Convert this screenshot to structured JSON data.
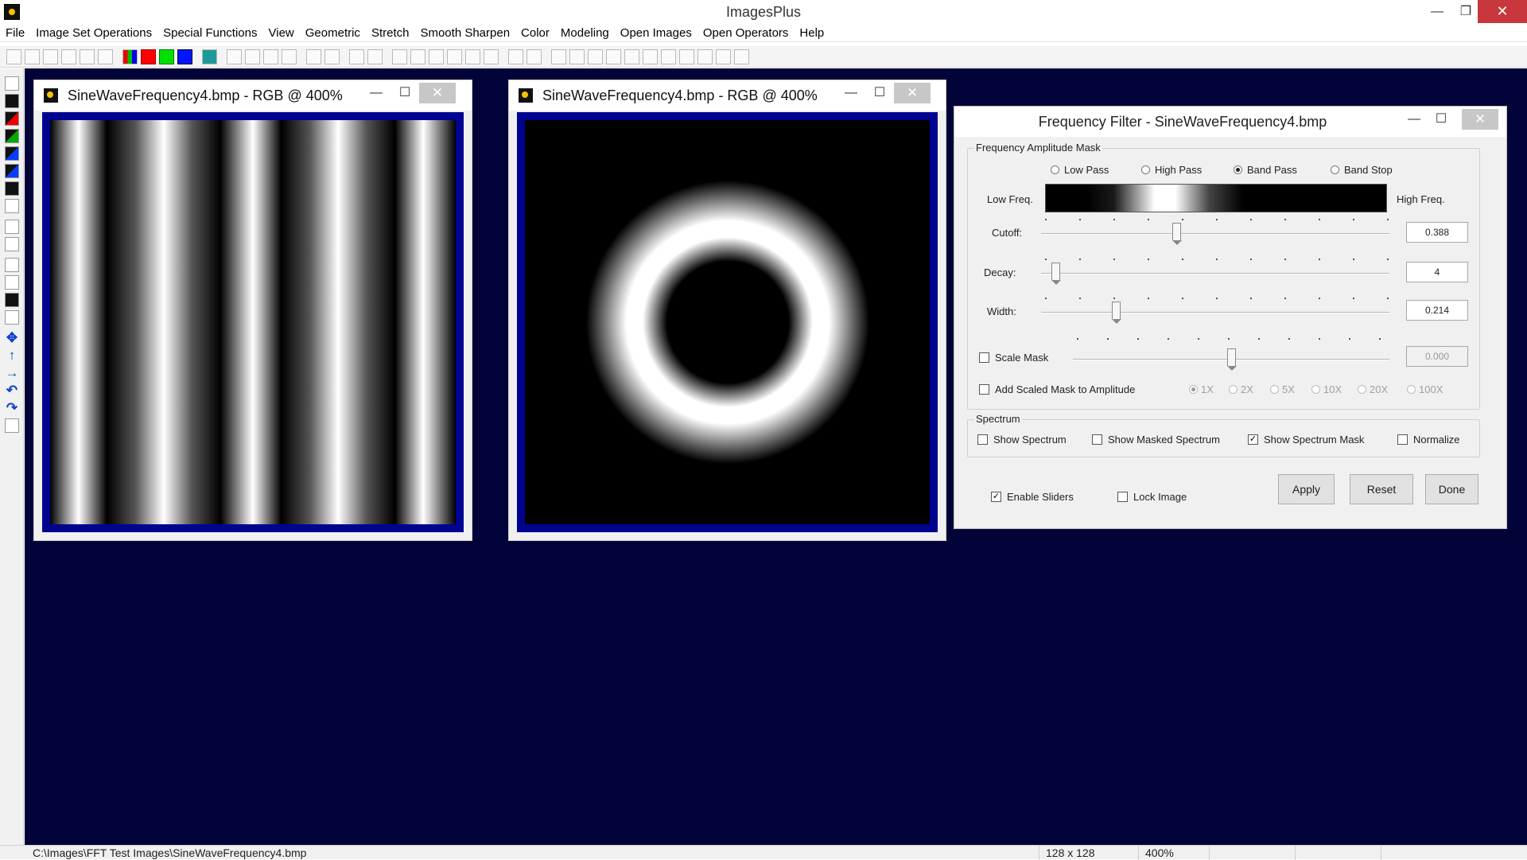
{
  "app": {
    "title": "ImagesPlus"
  },
  "window_controls": {
    "minimize": "—",
    "restore": "❐",
    "close": "✕"
  },
  "menu": [
    "File",
    "Image Set Operations",
    "Special Functions",
    "View",
    "Geometric",
    "Stretch",
    "Smooth Sharpen",
    "Color",
    "Modeling",
    "Open Images",
    "Open Operators",
    "Help"
  ],
  "image_windows": [
    {
      "title": "SineWaveFrequency4.bmp - RGB @ 400%"
    },
    {
      "title": "SineWaveFrequency4.bmp - RGB @ 400%"
    }
  ],
  "dialog": {
    "title": "Frequency Filter - SineWaveFrequency4.bmp",
    "amplitude_group": "Frequency Amplitude Mask",
    "filter_types": [
      {
        "label": "Low Pass",
        "checked": false
      },
      {
        "label": "High Pass",
        "checked": false
      },
      {
        "label": "Band Pass",
        "checked": true
      },
      {
        "label": "Band Stop",
        "checked": false
      }
    ],
    "low_freq_label": "Low Freq.",
    "high_freq_label": "High Freq.",
    "cutoff": {
      "label": "Cutoff:",
      "value": "0.388",
      "position": 0.388
    },
    "decay": {
      "label": "Decay:",
      "value": "4",
      "position": 0.04
    },
    "width": {
      "label": "Width:",
      "value": "0.214",
      "position": 0.214
    },
    "scale_mask": {
      "label": "Scale Mask",
      "checked": false,
      "value": "0.000",
      "position": 0.5
    },
    "add_scaled_mask": {
      "label": "Add Scaled Mask to Amplitude",
      "checked": false
    },
    "multipliers": [
      {
        "label": "1X",
        "checked": true
      },
      {
        "label": "2X",
        "checked": false
      },
      {
        "label": "5X",
        "checked": false
      },
      {
        "label": "10X",
        "checked": false
      },
      {
        "label": "20X",
        "checked": false
      },
      {
        "label": "100X",
        "checked": false
      }
    ],
    "spectrum_group": "Spectrum",
    "spectrum_options": [
      {
        "label": "Show Spectrum",
        "checked": false
      },
      {
        "label": "Show Masked Spectrum",
        "checked": false
      },
      {
        "label": "Show Spectrum Mask",
        "checked": true
      },
      {
        "label": "Normalize",
        "checked": false
      }
    ],
    "enable_sliders": {
      "label": "Enable Sliders",
      "checked": true
    },
    "lock_image": {
      "label": "Lock Image",
      "checked": false
    },
    "buttons": {
      "apply": "Apply",
      "reset": "Reset",
      "done": "Done"
    }
  },
  "status": {
    "path": "C:\\Images\\FFT Test Images\\SineWaveFrequency4.bmp",
    "size": "128 x 128",
    "zoom": "400%"
  }
}
